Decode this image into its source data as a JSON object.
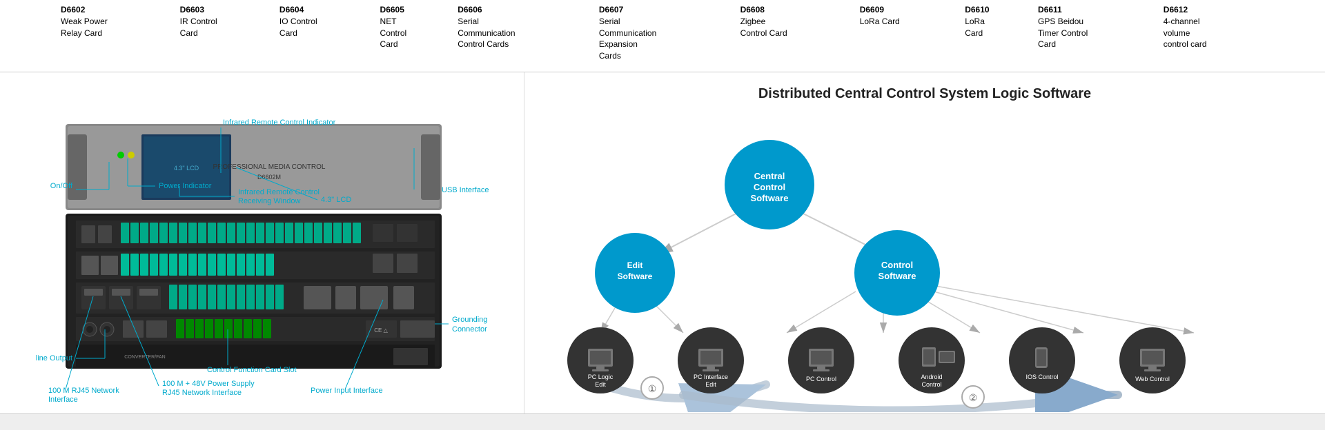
{
  "top_table": {
    "columns": [
      {
        "id": "D6602",
        "line1": "D6602",
        "line2": "Weak Power",
        "line3": "Relay Card"
      },
      {
        "id": "D6603",
        "line1": "D6603",
        "line2": "IR Control",
        "line3": "Card"
      },
      {
        "id": "D6604",
        "line1": "D6604",
        "line2": "IO Control",
        "line3": "Card"
      },
      {
        "id": "D6605",
        "line1": "D6605",
        "line2": "NET",
        "line3": "Control",
        "line4": "Card"
      },
      {
        "id": "D6606",
        "line1": "D6606",
        "line2": "Serial",
        "line3": "Communication",
        "line4": "Control Cards"
      },
      {
        "id": "D6607",
        "line1": "D6607",
        "line2": "Serial",
        "line3": "Communication",
        "line4": "Expansion",
        "line5": "Cards"
      },
      {
        "id": "D6608",
        "line1": "D6608",
        "line2": "Zigbee",
        "line3": "Control Card"
      },
      {
        "id": "D6609",
        "line1": "D6609",
        "line2": "LoRa",
        "line3": "Card"
      },
      {
        "id": "D6610",
        "line1": "D6610",
        "line2": "LoRa",
        "line3": "Card"
      },
      {
        "id": "D6611",
        "line1": "D6611",
        "line2": "GPS Beidou",
        "line3": "Timer Control",
        "line4": "Card"
      },
      {
        "id": "D6612",
        "line1": "D6612",
        "line2": "4-channel",
        "line3": "volume",
        "line4": "control card"
      }
    ]
  },
  "labels": {
    "onoff": "On/Off",
    "power_indicator": "Power Indicator",
    "infrared_indicator": "Infrared Remote Control Indicator",
    "infrared_window": "Infrared Remote Control\nReceiving Window",
    "lcd": "4.3\" LCD",
    "usb": "USB Interface",
    "grounding": "Grounding\nConnector",
    "line_output": "line Output",
    "control_slot": "Control Function Card Slot",
    "rj45_100m": "100 M RJ45 Network\nInterface",
    "power_48v": "100 M + 48V Power Supply\nRJ45 Network Interface",
    "power_input": "Power Input Interface"
  },
  "diagram": {
    "title": "Distributed Central Control System Logic Software",
    "nodes": {
      "central": "Central\nControl\nSoftware",
      "edit": "Edit Software",
      "control": "Control\nSoftware",
      "pc_logic": "PC Logic\nEdit",
      "pc_interface": "PC Interface\nEdit",
      "pc_control": "PC Control",
      "android": "Android\nControl",
      "ios": "IOS Control",
      "web": "Web Control"
    },
    "numbers": [
      "①",
      "②"
    ]
  },
  "colors": {
    "label_color": "#00aacc",
    "blue_circle": "#0099cc",
    "dark_circle": "#2a2a2a",
    "title_color": "#222222"
  }
}
